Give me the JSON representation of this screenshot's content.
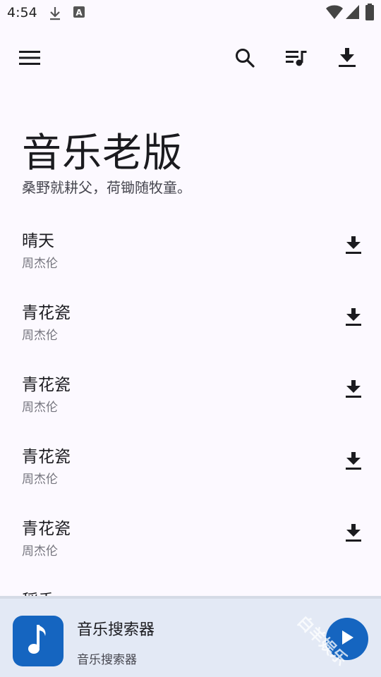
{
  "status_bar": {
    "time": "4:54",
    "icons": [
      "download-icon",
      "a-icon",
      "wifi-icon",
      "signal-icon",
      "battery-icon"
    ]
  },
  "app_bar": {
    "icons": [
      "menu-icon",
      "search-icon",
      "playlist-icon",
      "download-icon"
    ]
  },
  "hero": {
    "title": "音乐老版",
    "subtitle": "桑野就耕父，荷锄随牧童。"
  },
  "songs": [
    {
      "title": "晴天",
      "artist": "周杰伦"
    },
    {
      "title": "青花瓷",
      "artist": "周杰伦"
    },
    {
      "title": "青花瓷",
      "artist": "周杰伦"
    },
    {
      "title": "青花瓷",
      "artist": "周杰伦"
    },
    {
      "title": "青花瓷",
      "artist": "周杰伦"
    },
    {
      "title": "稻香",
      "artist": ""
    }
  ],
  "player": {
    "title": "音乐搜索器",
    "subtitle": "音乐搜索器",
    "art_icon": "music-note-icon",
    "play_icon": "play-icon"
  },
  "watermark": "白羊娱乐",
  "colors": {
    "background": "#fcf9ff",
    "accent": "#1565c0",
    "player_bg": "#e3e9f5"
  }
}
